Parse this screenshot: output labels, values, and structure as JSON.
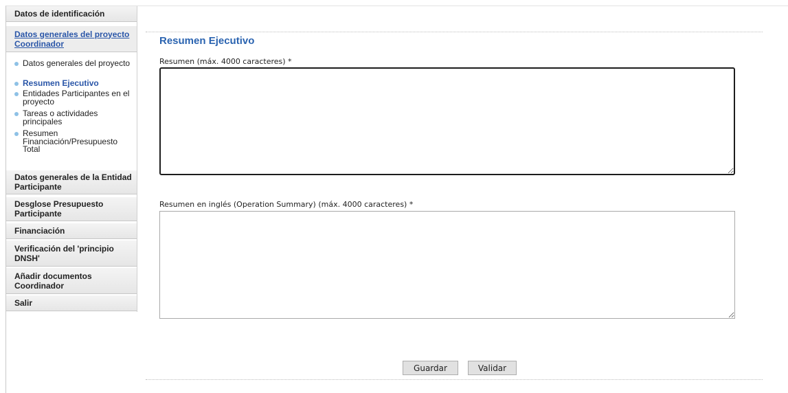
{
  "sidebar": {
    "sections": [
      {
        "label": "Datos de identificación"
      },
      {
        "label": "Datos generales del proyecto Coordinador"
      },
      {
        "label": "Datos generales de la Entidad Participante"
      },
      {
        "label": "Desglose Presupuesto Participante"
      },
      {
        "label": "Financiación"
      },
      {
        "label": "Verificación del 'principio DNSH'"
      },
      {
        "label": "Añadir documentos Coordinador"
      },
      {
        "label": "Salir"
      }
    ],
    "subitems": [
      {
        "label": "Datos generales del proyecto"
      },
      {
        "label": "Resumen Ejecutivo"
      },
      {
        "label": "Entidades Participantes en el proyecto"
      },
      {
        "label": "Tareas o actividades principales"
      },
      {
        "label": "Resumen Financiación/Presupuesto Total"
      }
    ]
  },
  "main": {
    "title": "Resumen Ejecutivo",
    "fields": [
      {
        "label": "Resumen (máx. 4000 caracteres) *",
        "value": ""
      },
      {
        "label": "Resumen en inglés (Operation Summary) (máx. 4000 caracteres) *",
        "value": ""
      }
    ]
  },
  "buttons": {
    "save": "Guardar",
    "validate": "Validar"
  },
  "colors": {
    "accent": "#2a63b0",
    "link": "#2a56a8",
    "bullet": "#8ec1e6"
  }
}
